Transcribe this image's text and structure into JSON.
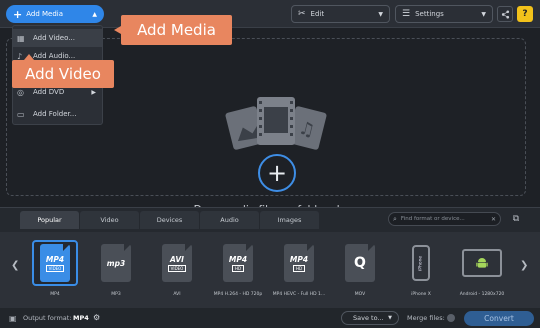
{
  "toolbar": {
    "add_media_label": "Add Media",
    "edit_label": "Edit",
    "settings_label": "Settings",
    "help_label": "?"
  },
  "dropdown": {
    "items": [
      {
        "label": "Add Video...",
        "icon": "film-icon"
      },
      {
        "label": "Add Audio...",
        "icon": "music-note-icon"
      },
      {
        "label": "Add DVD",
        "icon": "disc-icon"
      },
      {
        "label": "Add Folder...",
        "icon": "folder-icon"
      }
    ]
  },
  "callouts": {
    "add_media": "Add Media",
    "add_video": "Add Video"
  },
  "dropzone": {
    "text": "Drag media files or folders here"
  },
  "tabs": [
    "Popular",
    "Video",
    "Devices",
    "Audio",
    "Images"
  ],
  "active_tab": "Popular",
  "search": {
    "placeholder": "Find format or device..."
  },
  "formats": [
    {
      "label": "MP4",
      "big": "MP4",
      "small": "VIDEO",
      "kind": "doc",
      "selected": true
    },
    {
      "label": "MP3",
      "big": "mp3",
      "small": "",
      "kind": "doc",
      "selected": false
    },
    {
      "label": "AVI",
      "big": "AVI",
      "small": "VIDEO",
      "kind": "doc",
      "selected": false
    },
    {
      "label": "MP4 H.264 - HD 720p",
      "big": "MP4",
      "small": "HD",
      "kind": "doc",
      "selected": false
    },
    {
      "label": "MP4 HEVC - Full HD 1...",
      "big": "MP4",
      "small": "HD",
      "kind": "doc",
      "selected": false
    },
    {
      "label": "MOV",
      "big": "Q",
      "small": "",
      "kind": "doc",
      "selected": false
    },
    {
      "label": "iPhone X",
      "big": "iPhone",
      "small": "",
      "kind": "phone",
      "selected": false
    },
    {
      "label": "Android - 1280x720",
      "big": "",
      "small": "",
      "kind": "tablet",
      "selected": false
    }
  ],
  "status": {
    "output_label": "Output format:",
    "output_value": "MP4",
    "save_label": "Save to...",
    "merge_label": "Merge files:",
    "convert_label": "Convert"
  },
  "colors": {
    "accent": "#2f86e8",
    "callout": "#e8865f",
    "help": "#f2c21b"
  }
}
